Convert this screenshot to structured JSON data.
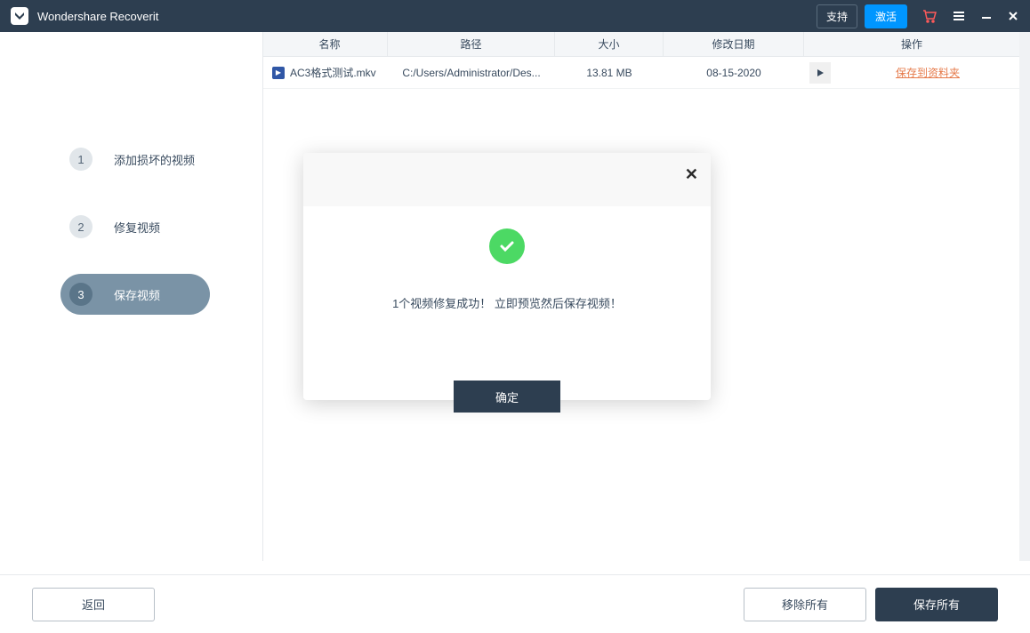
{
  "header": {
    "title": "Wondershare Recoverit",
    "support_label": "支持",
    "activate_label": "激活"
  },
  "sidebar": {
    "steps": [
      {
        "num": "1",
        "label": "添加损坏的视频"
      },
      {
        "num": "2",
        "label": "修复视频"
      },
      {
        "num": "3",
        "label": "保存视频"
      }
    ]
  },
  "table": {
    "headers": {
      "name": "名称",
      "path": "路径",
      "size": "大小",
      "date": "修改日期",
      "action": "操作"
    },
    "rows": [
      {
        "name": "AC3格式测试.mkv",
        "path": "C:/Users/Administrator/Des...",
        "size": "13.81 MB",
        "date": "08-15-2020",
        "action": "保存到资料夹"
      }
    ]
  },
  "footer": {
    "back": "返回",
    "remove_all": "移除所有",
    "save_all": "保存所有"
  },
  "modal": {
    "message": "1个视频修复成功！ 立即预览然后保存视频！",
    "ok": "确定"
  }
}
